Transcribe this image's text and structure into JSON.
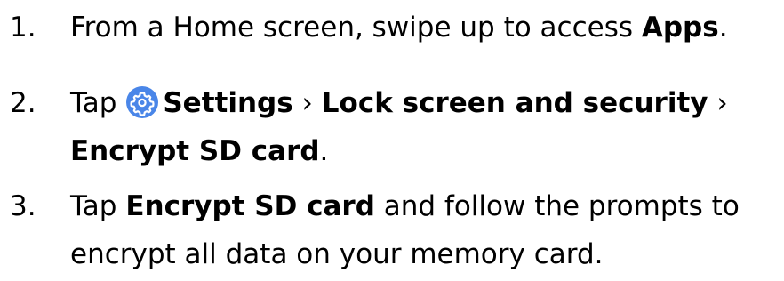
{
  "steps": [
    {
      "number": "1.",
      "text_before": "From a Home screen, swipe up to access ",
      "bold": "Apps",
      "text_after": "."
    },
    {
      "number": "2.",
      "tap": "Tap",
      "settings_icon": "settings-gear-icon",
      "bold_settings": "Settings",
      "separator1": "›",
      "bold_lock": "Lock screen and security",
      "separator2": "›",
      "bold_encrypt": "Encrypt SD card",
      "text_after": "."
    },
    {
      "number": "3.",
      "tap": "Tap ",
      "bold": "Encrypt SD card",
      "text_after_line1": " and follow the prompts to",
      "line2": "encrypt all data on your memory card."
    }
  ],
  "colors": {
    "text": "#000000",
    "icon_bg": "#4a86e8",
    "icon_fg": "#ffffff"
  }
}
